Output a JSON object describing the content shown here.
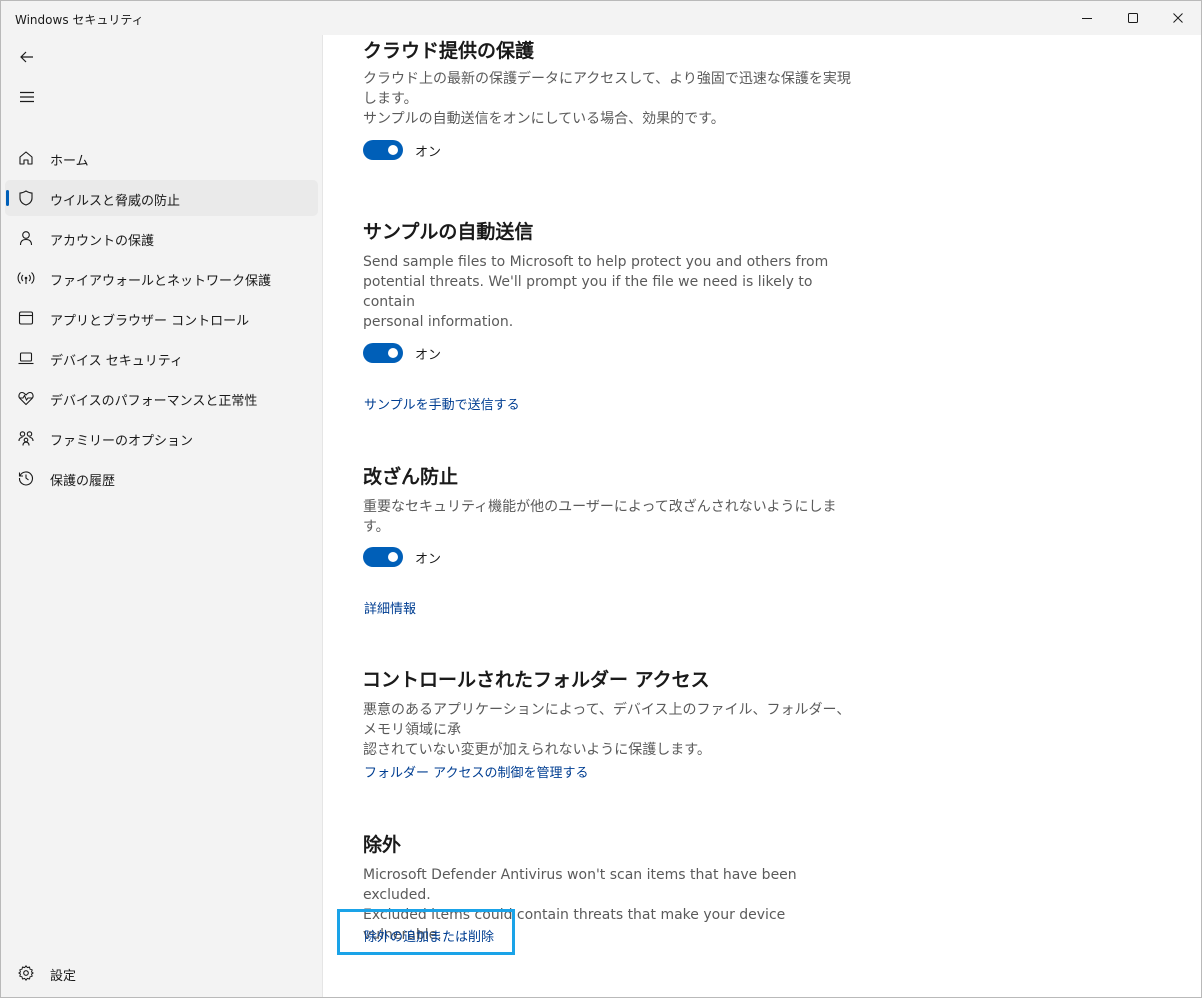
{
  "window": {
    "title": "Windows セキュリティ"
  },
  "sidebar": {
    "items": [
      {
        "label": "ホーム",
        "icon": "home-icon",
        "active": false
      },
      {
        "label": "ウイルスと脅威の防止",
        "icon": "shield-icon",
        "active": true
      },
      {
        "label": "アカウントの保護",
        "icon": "person-icon",
        "active": false
      },
      {
        "label": "ファイアウォールとネットワーク保護",
        "icon": "wireless-icon",
        "active": false
      },
      {
        "label": "アプリとブラウザー コントロール",
        "icon": "app-window-icon",
        "active": false
      },
      {
        "label": "デバイス セキュリティ",
        "icon": "laptop-icon",
        "active": false
      },
      {
        "label": "デバイスのパフォーマンスと正常性",
        "icon": "heart-pulse-icon",
        "active": false
      },
      {
        "label": "ファミリーのオプション",
        "icon": "family-icon",
        "active": false
      },
      {
        "label": "保護の履歴",
        "icon": "history-icon",
        "active": false
      }
    ],
    "settings_label": "設定"
  },
  "content": {
    "cloud": {
      "title": "クラウド提供の保護",
      "desc_line1": "クラウド上の最新の保護データにアクセスして、より強固で迅速な保護を実現します。",
      "desc_line2": "サンプルの自動送信をオンにしている場合、効果的です。",
      "toggle_label": "オン"
    },
    "sample": {
      "title": "サンプルの自動送信",
      "desc_line1": "Send sample files to Microsoft to help protect you and others from",
      "desc_line2": "potential threats. We'll prompt you if the file we need is likely to contain",
      "desc_line3": "personal information.",
      "toggle_label": "オン",
      "link": "サンプルを手動で送信する"
    },
    "tamper": {
      "title": "改ざん防止",
      "desc_line1": "重要なセキュリティ機能が他のユーザーによって改ざんされないようにします。",
      "toggle_label": "オン",
      "link": "詳細情報"
    },
    "folder": {
      "title": "コントロールされたフォルダー アクセス",
      "desc_line1": "悪意のあるアプリケーションによって、デバイス上のファイル、フォルダー、メモリ領域に承",
      "desc_line2": "認されていない変更が加えられないように保護します。",
      "link": "フォルダー アクセスの制御を管理する"
    },
    "exclusions": {
      "title": "除外",
      "desc_line1": "Microsoft Defender Antivirus won't scan items that have been excluded.",
      "desc_line2": "Excluded items could contain threats that make your device vulnerable.",
      "link": "除外の追加または削除"
    }
  },
  "colors": {
    "accent": "#005fb8",
    "link": "#003e92",
    "focus": "#1aa3e8"
  }
}
